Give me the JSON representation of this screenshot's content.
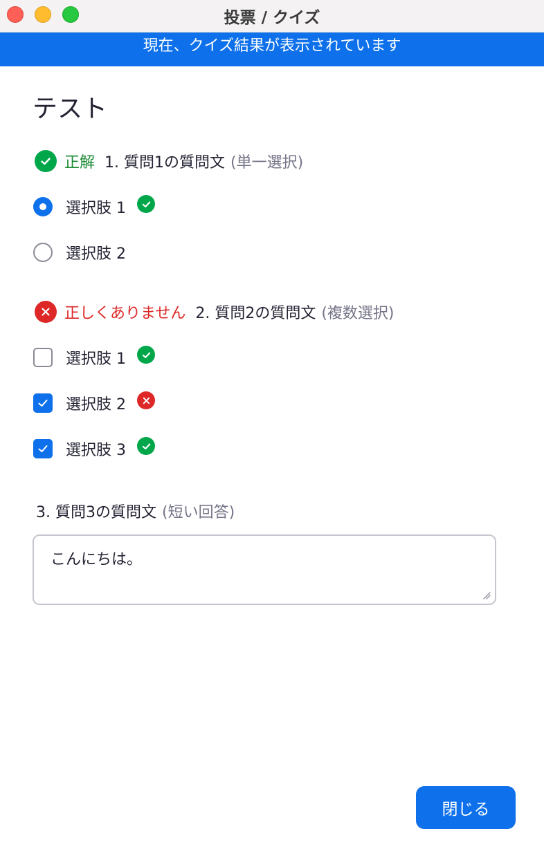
{
  "window": {
    "title": "投票 / クイズ"
  },
  "banner": {
    "text": "現在、クイズ結果が表示されています",
    "color": "#0e71eb"
  },
  "quiz": {
    "title": "テスト",
    "questions": [
      {
        "status": "correct",
        "status_label": "正解",
        "text": "1. 質問1の質問文",
        "hint": "(単一選択)",
        "type": "single",
        "options": [
          {
            "label": "選択肢 1",
            "selected": true,
            "mark": "correct"
          },
          {
            "label": "選択肢 2",
            "selected": false,
            "mark": "none"
          }
        ]
      },
      {
        "status": "wrong",
        "status_label": "正しくありません",
        "text": "2. 質問2の質問文",
        "hint": "(複数選択)",
        "type": "multiple",
        "options": [
          {
            "label": "選択肢 1",
            "selected": false,
            "mark": "correct"
          },
          {
            "label": "選択肢 2",
            "selected": true,
            "mark": "wrong"
          },
          {
            "label": "選択肢 3",
            "selected": true,
            "mark": "correct"
          }
        ]
      },
      {
        "text": "3. 質問3の質問文",
        "hint": "(短い回答)",
        "type": "short",
        "answer": "こんにちは。"
      }
    ]
  },
  "footer": {
    "close_label": "閉じる"
  },
  "colors": {
    "accent": "#0e71eb",
    "correct": "#00a74a",
    "wrong": "#de2828"
  }
}
